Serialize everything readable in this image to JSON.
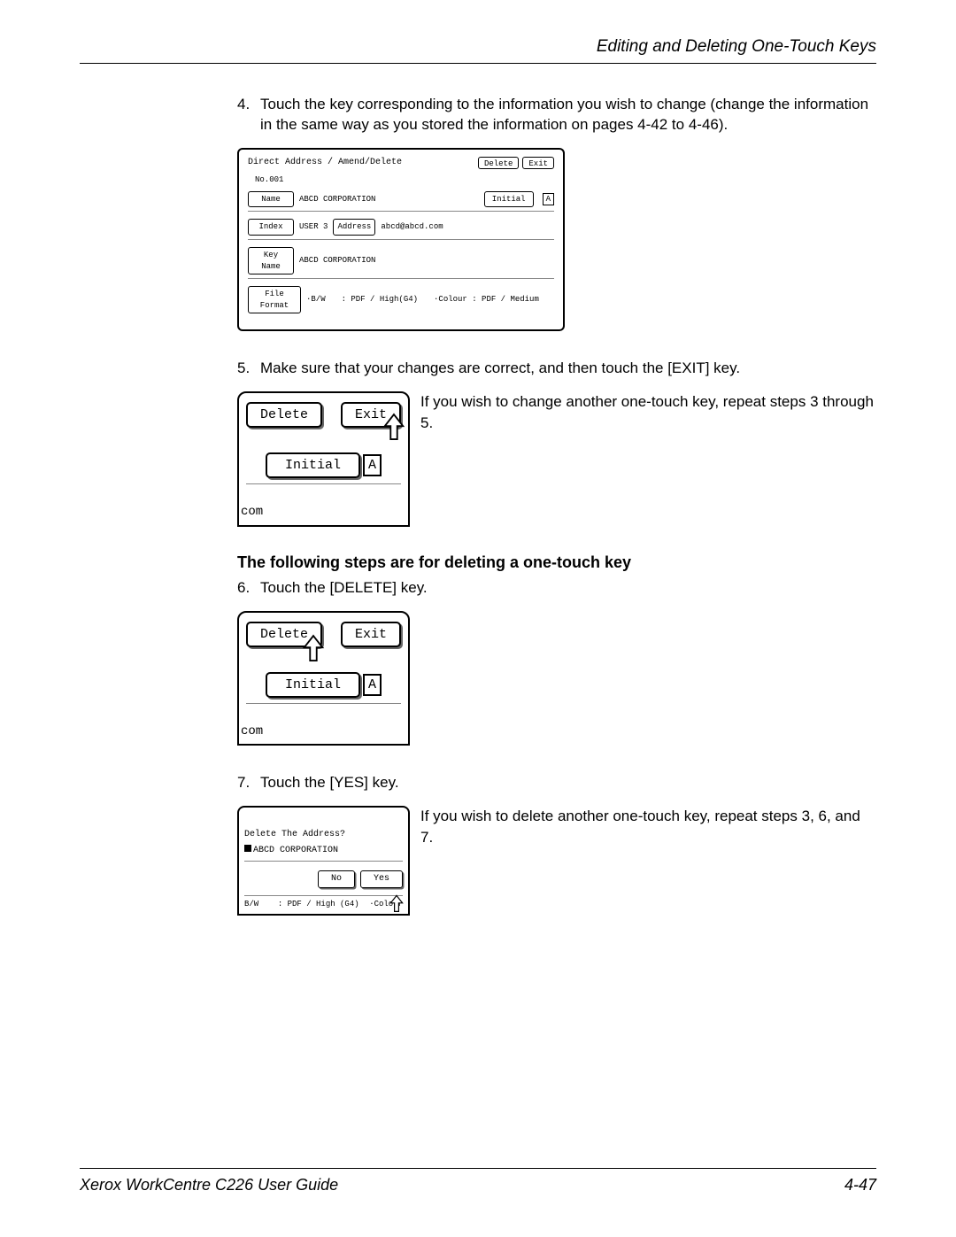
{
  "header": "Editing and Deleting One-Touch Keys",
  "step4_num": "4.",
  "step4_text": "Touch the key corresponding to the information you wish to change (change the information in the same way as you stored the information on pages 4-42 to 4-46).",
  "fig1": {
    "title": "Direct Address / Amend/Delete",
    "delete": "Delete",
    "exit": "Exit",
    "no": "No.001",
    "name_label": "Name",
    "name_val": "ABCD CORPORATION",
    "initial_label": "Initial",
    "initial_a": "A",
    "index_label": "Index",
    "index_val": "USER 3",
    "address_label": "Address",
    "address_val": "abcd@abcd.com",
    "keyname_label": "Key Name",
    "keyname_val": "ABCD CORPORATION",
    "fileformat_label": "File Format",
    "fileformat_bw": "·B/W",
    "fileformat_bw_val": ": PDF / High(G4)",
    "fileformat_colour": "·Colour : PDF / Medium"
  },
  "step5_num": "5.",
  "step5_text": "Make sure that your changes are correct, and then touch the [EXIT] key.",
  "fig2": {
    "delete": "Delete",
    "exit": "Exit",
    "initial": "Initial",
    "a": "A",
    "com": "com"
  },
  "step5_right": "If you wish to change another one-touch key, repeat steps 3 through 5.",
  "section_heading": "The following steps are for deleting a one-touch key",
  "step6_num": "6.",
  "step6_text": "Touch the [DELETE] key.",
  "fig3": {
    "delete": "Delete",
    "exit": "Exit",
    "initial": "Initial",
    "a": "A",
    "com": "com"
  },
  "step7_num": "7.",
  "step7_text": "Touch the [YES] key.",
  "fig4": {
    "question": "Delete The Address?",
    "name": "ABCD CORPORATION",
    "no_btn": "No",
    "yes_btn": "Yes",
    "bw": "B/W",
    "bw_val": ": PDF / High (G4)",
    "colour": "·Colour"
  },
  "step7_right": "If you wish to delete another one-touch key, repeat steps 3, 6, and 7.",
  "footer_left": "Xerox WorkCentre C226 User Guide",
  "footer_right": "4-47"
}
